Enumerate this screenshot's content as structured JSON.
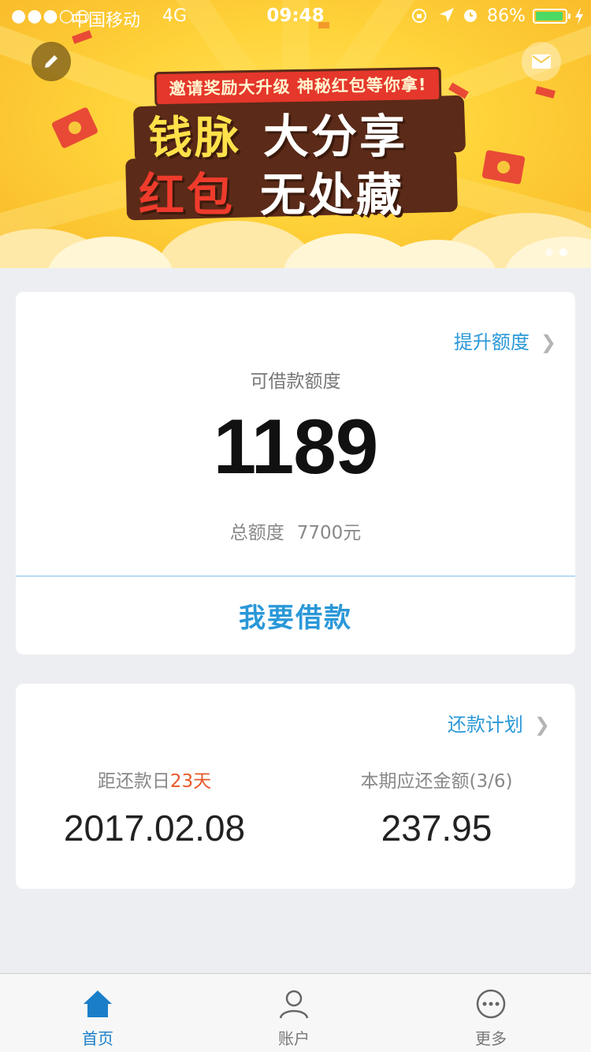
{
  "status_bar": {
    "signal": "●●●○○",
    "carrier": "中国移动",
    "network": "4G",
    "time": "09:48",
    "battery_percent": "86%"
  },
  "banner": {
    "subtitle": "邀请奖励大升级  神秘红包等你拿!",
    "line1_a": "钱脉",
    "line1_b": "大分享",
    "line2_a": "红包",
    "line2_b": "无处藏",
    "edit_icon": "pencil-icon",
    "mail_icon": "mail-icon"
  },
  "credit_card": {
    "raise_limit_link": "提升额度",
    "available_label": "可借款额度",
    "available_amount": "1189",
    "total_label": "总额度",
    "total_amount": "7700元",
    "borrow_button": "我要借款"
  },
  "repay_card": {
    "plan_link": "还款计划",
    "days_label_prefix": "距还款日",
    "days_value": "23天",
    "due_date": "2017.02.08",
    "amount_label": "本期应还金额(3/6)",
    "amount_value": "237.95"
  },
  "tabbar": {
    "items": [
      {
        "label": "首页",
        "icon": "home-icon",
        "active": true
      },
      {
        "label": "账户",
        "icon": "user-icon",
        "active": false
      },
      {
        "label": "更多",
        "icon": "more-icon",
        "active": false
      }
    ]
  },
  "colors": {
    "accent_blue": "#2a98d8",
    "highlight_orange": "#e8582a",
    "banner_yellow": "#ffd33a",
    "tab_active": "#1a7ec8"
  }
}
